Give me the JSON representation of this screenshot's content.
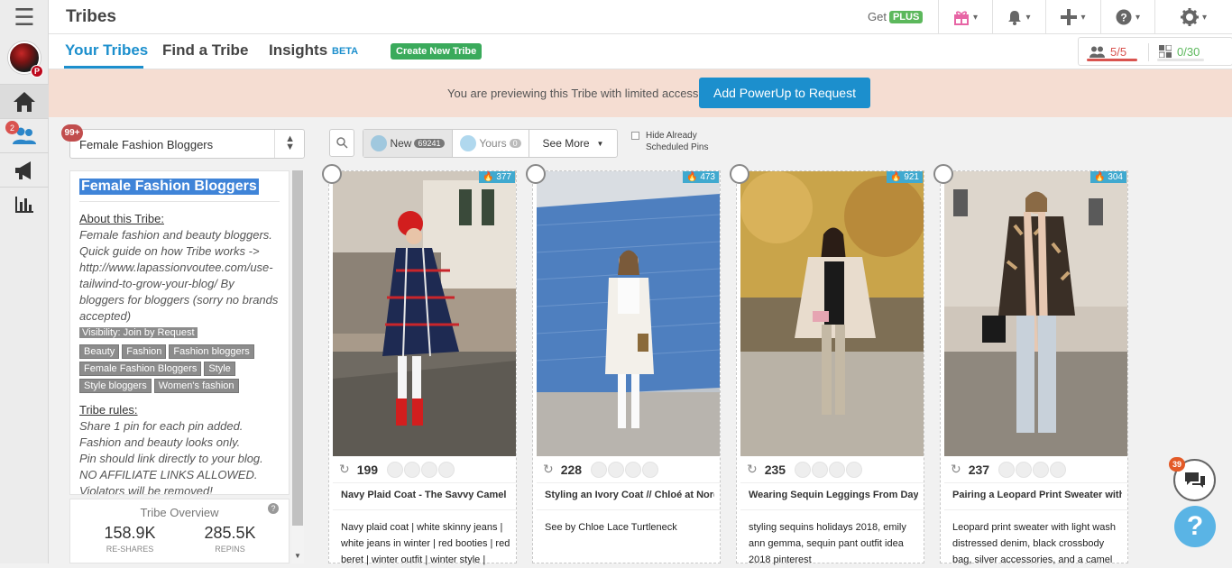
{
  "app": {
    "title": "Tribes"
  },
  "topbar": {
    "get_label": "Get",
    "plus_label": "PLUS"
  },
  "tabs": [
    {
      "label": "Your Tribes"
    },
    {
      "label": "Find a Tribe"
    },
    {
      "label": "Insights"
    }
  ],
  "beta_label": "BETA",
  "create_label": "Create New Tribe",
  "quota": {
    "members": "5/5",
    "pins": "0/30",
    "members_color": "#d9534f",
    "pins_color": "#5cb85c"
  },
  "nav": {
    "tribes_badge": "2"
  },
  "banner": {
    "text": "You are previewing this Tribe with limited access",
    "button": "Add PowerUp to Request"
  },
  "tribe_select": {
    "value": "Female Fashion Bloggers",
    "badge": "99+"
  },
  "tribe_info": {
    "title": "Female Fashion Bloggers",
    "about_label": "About this Tribe:",
    "about_text": "Female fashion and beauty bloggers. Quick guide on how Tribe works -> http://www.lapassionvoutee.com/use-tailwind-to-grow-your-blog/ By bloggers for bloggers (sorry no brands accepted)",
    "visibility": "Visibility: Join by Request",
    "tags": [
      "Beauty",
      "Fashion",
      "Fashion bloggers",
      "Female Fashion Bloggers",
      "Style",
      "Style bloggers",
      "Women's fashion"
    ],
    "rules_label": "Tribe rules:",
    "rules_text": [
      "Share 1 pin for each pin added.",
      "Fashion and beauty looks only.",
      "Pin should link directly to your blog.",
      "NO AFFILIATE LINKS ALLOWED.",
      "Violators will be removed!"
    ]
  },
  "overview": {
    "title": "Tribe Overview",
    "reshares_value": "158.9K",
    "reshares_label": "RE-SHARES",
    "repins_value": "285.5K",
    "repins_label": "REPINS"
  },
  "filters": {
    "new_label": "New",
    "new_count": "69241",
    "yours_label": "Yours",
    "yours_count": "0",
    "more_label": "See More",
    "hide_label_1": "Hide Already",
    "hide_label_2": "Scheduled Pins"
  },
  "pins": [
    {
      "score": "377",
      "repins": "199",
      "title": "Navy Plaid Coat - The Savvy Camel",
      "desc": "Navy plaid coat | white skinny jeans | white jeans in winter | red booties | red beret | winter outfit | winter style |"
    },
    {
      "score": "473",
      "repins": "228",
      "title": "Styling an Ivory Coat // Chloé at Nordstrom",
      "desc": "See by Chloe Lace Turtleneck"
    },
    {
      "score": "921",
      "repins": "235",
      "title": "Wearing Sequin Leggings From Day",
      "desc": "styling sequins holidays 2018, emily ann gemma, sequin pant outfit idea 2018 pinterest"
    },
    {
      "score": "304",
      "repins": "237",
      "title": "Pairing a Leopard Print Sweater with",
      "desc": "Leopard print sweater with light wash distressed denim, black crossbody bag, silver accessories, and a camel"
    }
  ],
  "chat_badge": "39",
  "help_label": "?"
}
